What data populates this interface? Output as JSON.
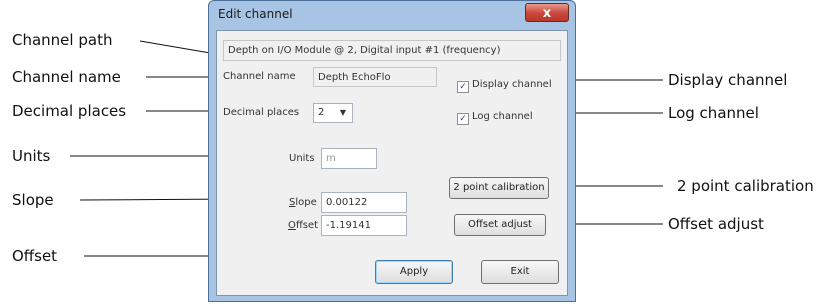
{
  "callouts_left": {
    "channel_path": "Channel path",
    "channel_name": "Channel name",
    "decimal_places": "Decimal places",
    "units": "Units",
    "slope": "Slope",
    "offset": "Offset"
  },
  "callouts_right": {
    "display_channel": "Display channel",
    "log_channel": "Log channel",
    "two_point_calibration": "2 point calibration",
    "offset_adjust": "Offset adjust"
  },
  "dialog": {
    "title": "Edit channel",
    "close_glyph": "x",
    "channel_path": "Depth on I/O Module @ 2, Digital input #1 (frequency)",
    "channel_name_label": "Channel name",
    "channel_name_value": "Depth EchoFlo",
    "display_channel_label": "Display channel",
    "display_channel_checked": true,
    "log_channel_label": "Log channel",
    "log_channel_checked": true,
    "decimal_places_label": "Decimal places",
    "decimal_places_value": "2",
    "units_label": "Units",
    "units_value": "m",
    "slope_label": "Slope",
    "slope_value": "0.00122",
    "offset_label": "Offset",
    "offset_value": "-1.19141",
    "two_point_calibration_button": "2 point calibration",
    "offset_adjust_button": "Offset adjust",
    "apply_button": "Apply",
    "exit_button": "Exit",
    "check_glyph": "✓",
    "dropdown_glyph": "▼"
  }
}
